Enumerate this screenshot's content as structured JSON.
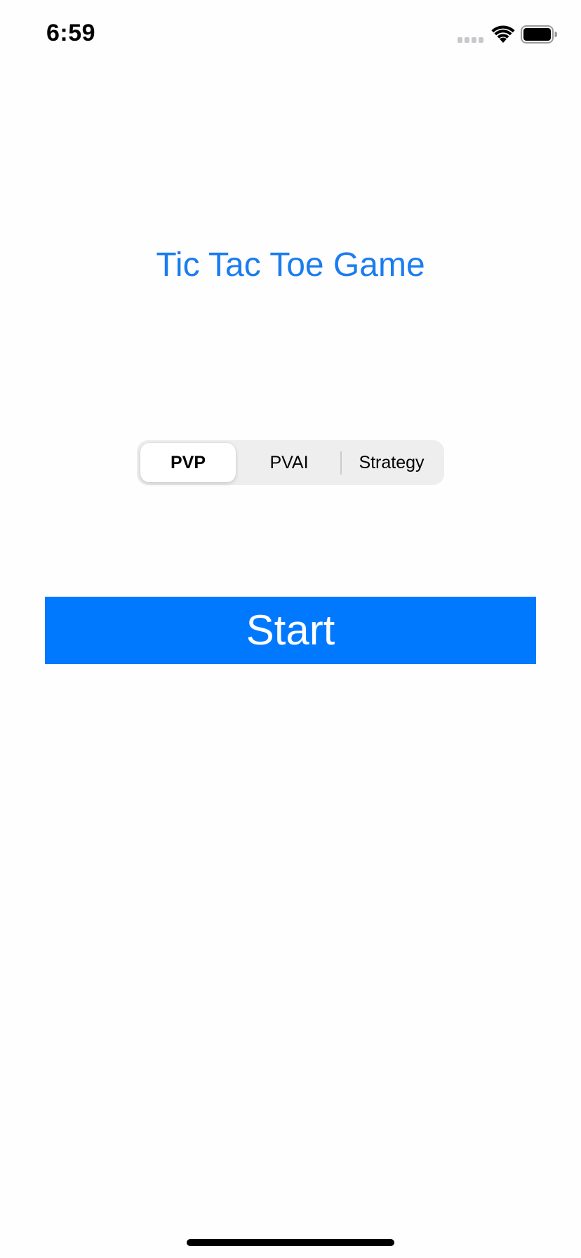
{
  "status_bar": {
    "time": "6:59",
    "icons": [
      "signal-icon",
      "wifi-icon",
      "battery-icon"
    ]
  },
  "title": "Tic Tac Toe Game",
  "mode_selector": {
    "options": [
      "PVP",
      "PVAI",
      "Strategy"
    ],
    "selected": "PVP"
  },
  "start_button": {
    "label": "Start"
  },
  "colors": {
    "accent": "#0079ff",
    "title": "#1a7cf1",
    "segment_bg": "#eeeeef",
    "background": "#fefefe"
  }
}
